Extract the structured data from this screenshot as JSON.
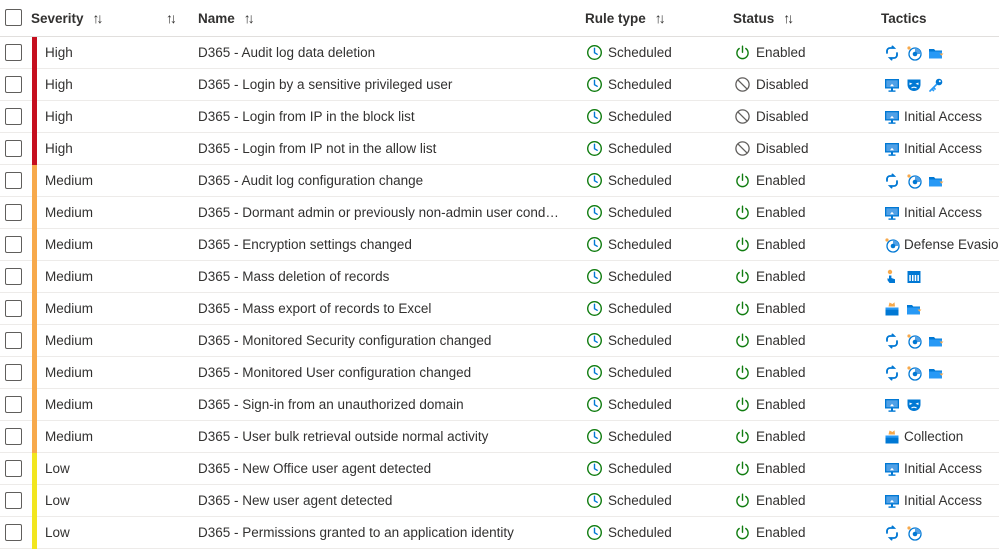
{
  "columns": {
    "severity": "Severity",
    "name": "Name",
    "rule_type": "Rule type",
    "status": "Status",
    "tactics": "Tactics"
  },
  "sort_glyph": "↑↓",
  "colors": {
    "High": "#c50f1f",
    "Medium": "#f7a94b",
    "Low": "#f2e61f",
    "scheduled": "#107c10",
    "enabled": "#107c10",
    "disabled": "#605e5c",
    "tactic_blue": "#0078d4"
  },
  "rows": [
    {
      "severity": "High",
      "name": "D365 - Audit log data deletion",
      "rule_type": "Scheduled",
      "status": "Enabled",
      "tactics": [
        "exfil-icon",
        "evasion-icon",
        "folder-icon"
      ],
      "tactic_label": ""
    },
    {
      "severity": "High",
      "name": "D365 - Login by a sensitive privileged user",
      "rule_type": "Scheduled",
      "status": "Disabled",
      "tactics": [
        "monitor-icon",
        "mask-icon",
        "key-icon"
      ],
      "tactic_label": ""
    },
    {
      "severity": "High",
      "name": "D365 - Login from IP in the block list",
      "rule_type": "Scheduled",
      "status": "Disabled",
      "tactics": [
        "monitor-icon"
      ],
      "tactic_label": "Initial Access"
    },
    {
      "severity": "High",
      "name": "D365 - Login from IP not in the allow list",
      "rule_type": "Scheduled",
      "status": "Disabled",
      "tactics": [
        "monitor-icon"
      ],
      "tactic_label": "Initial Access"
    },
    {
      "severity": "Medium",
      "name": "D365 - Audit log configuration change",
      "rule_type": "Scheduled",
      "status": "Enabled",
      "tactics": [
        "exfil-icon",
        "evasion-icon",
        "folder-icon"
      ],
      "tactic_label": ""
    },
    {
      "severity": "Medium",
      "name": "D365 - Dormant admin or previously non-admin user conduc...",
      "rule_type": "Scheduled",
      "status": "Enabled",
      "tactics": [
        "monitor-icon"
      ],
      "tactic_label": "Initial Access"
    },
    {
      "severity": "Medium",
      "name": "D365 - Encryption settings changed",
      "rule_type": "Scheduled",
      "status": "Enabled",
      "tactics": [
        "evasion-icon"
      ],
      "tactic_label": "Defense Evasion"
    },
    {
      "severity": "Medium",
      "name": "D365 - Mass deletion of records",
      "rule_type": "Scheduled",
      "status": "Enabled",
      "tactics": [
        "hand-icon",
        "server-icon"
      ],
      "tactic_label": ""
    },
    {
      "severity": "Medium",
      "name": "D365 - Mass export of records to Excel",
      "rule_type": "Scheduled",
      "status": "Enabled",
      "tactics": [
        "collection-icon",
        "folder-icon"
      ],
      "tactic_label": ""
    },
    {
      "severity": "Medium",
      "name": "D365 - Monitored Security configuration changed",
      "rule_type": "Scheduled",
      "status": "Enabled",
      "tactics": [
        "exfil-icon",
        "evasion-icon",
        "folder-icon"
      ],
      "tactic_label": ""
    },
    {
      "severity": "Medium",
      "name": "D365 - Monitored User configuration changed",
      "rule_type": "Scheduled",
      "status": "Enabled",
      "tactics": [
        "exfil-icon",
        "evasion-icon",
        "folder-icon"
      ],
      "tactic_label": ""
    },
    {
      "severity": "Medium",
      "name": "D365 - Sign-in from an unauthorized domain",
      "rule_type": "Scheduled",
      "status": "Enabled",
      "tactics": [
        "monitor-icon",
        "mask-icon"
      ],
      "tactic_label": ""
    },
    {
      "severity": "Medium",
      "name": "D365 - User bulk retrieval outside normal activity",
      "rule_type": "Scheduled",
      "status": "Enabled",
      "tactics": [
        "collection-icon"
      ],
      "tactic_label": "Collection"
    },
    {
      "severity": "Low",
      "name": "D365 - New Office user agent detected",
      "rule_type": "Scheduled",
      "status": "Enabled",
      "tactics": [
        "monitor-icon"
      ],
      "tactic_label": "Initial Access"
    },
    {
      "severity": "Low",
      "name": "D365 - New user agent detected",
      "rule_type": "Scheduled",
      "status": "Enabled",
      "tactics": [
        "monitor-icon"
      ],
      "tactic_label": "Initial Access"
    },
    {
      "severity": "Low",
      "name": "D365 - Permissions granted to an application identity",
      "rule_type": "Scheduled",
      "status": "Enabled",
      "tactics": [
        "exfil-icon",
        "evasion-icon"
      ],
      "tactic_label": ""
    }
  ]
}
